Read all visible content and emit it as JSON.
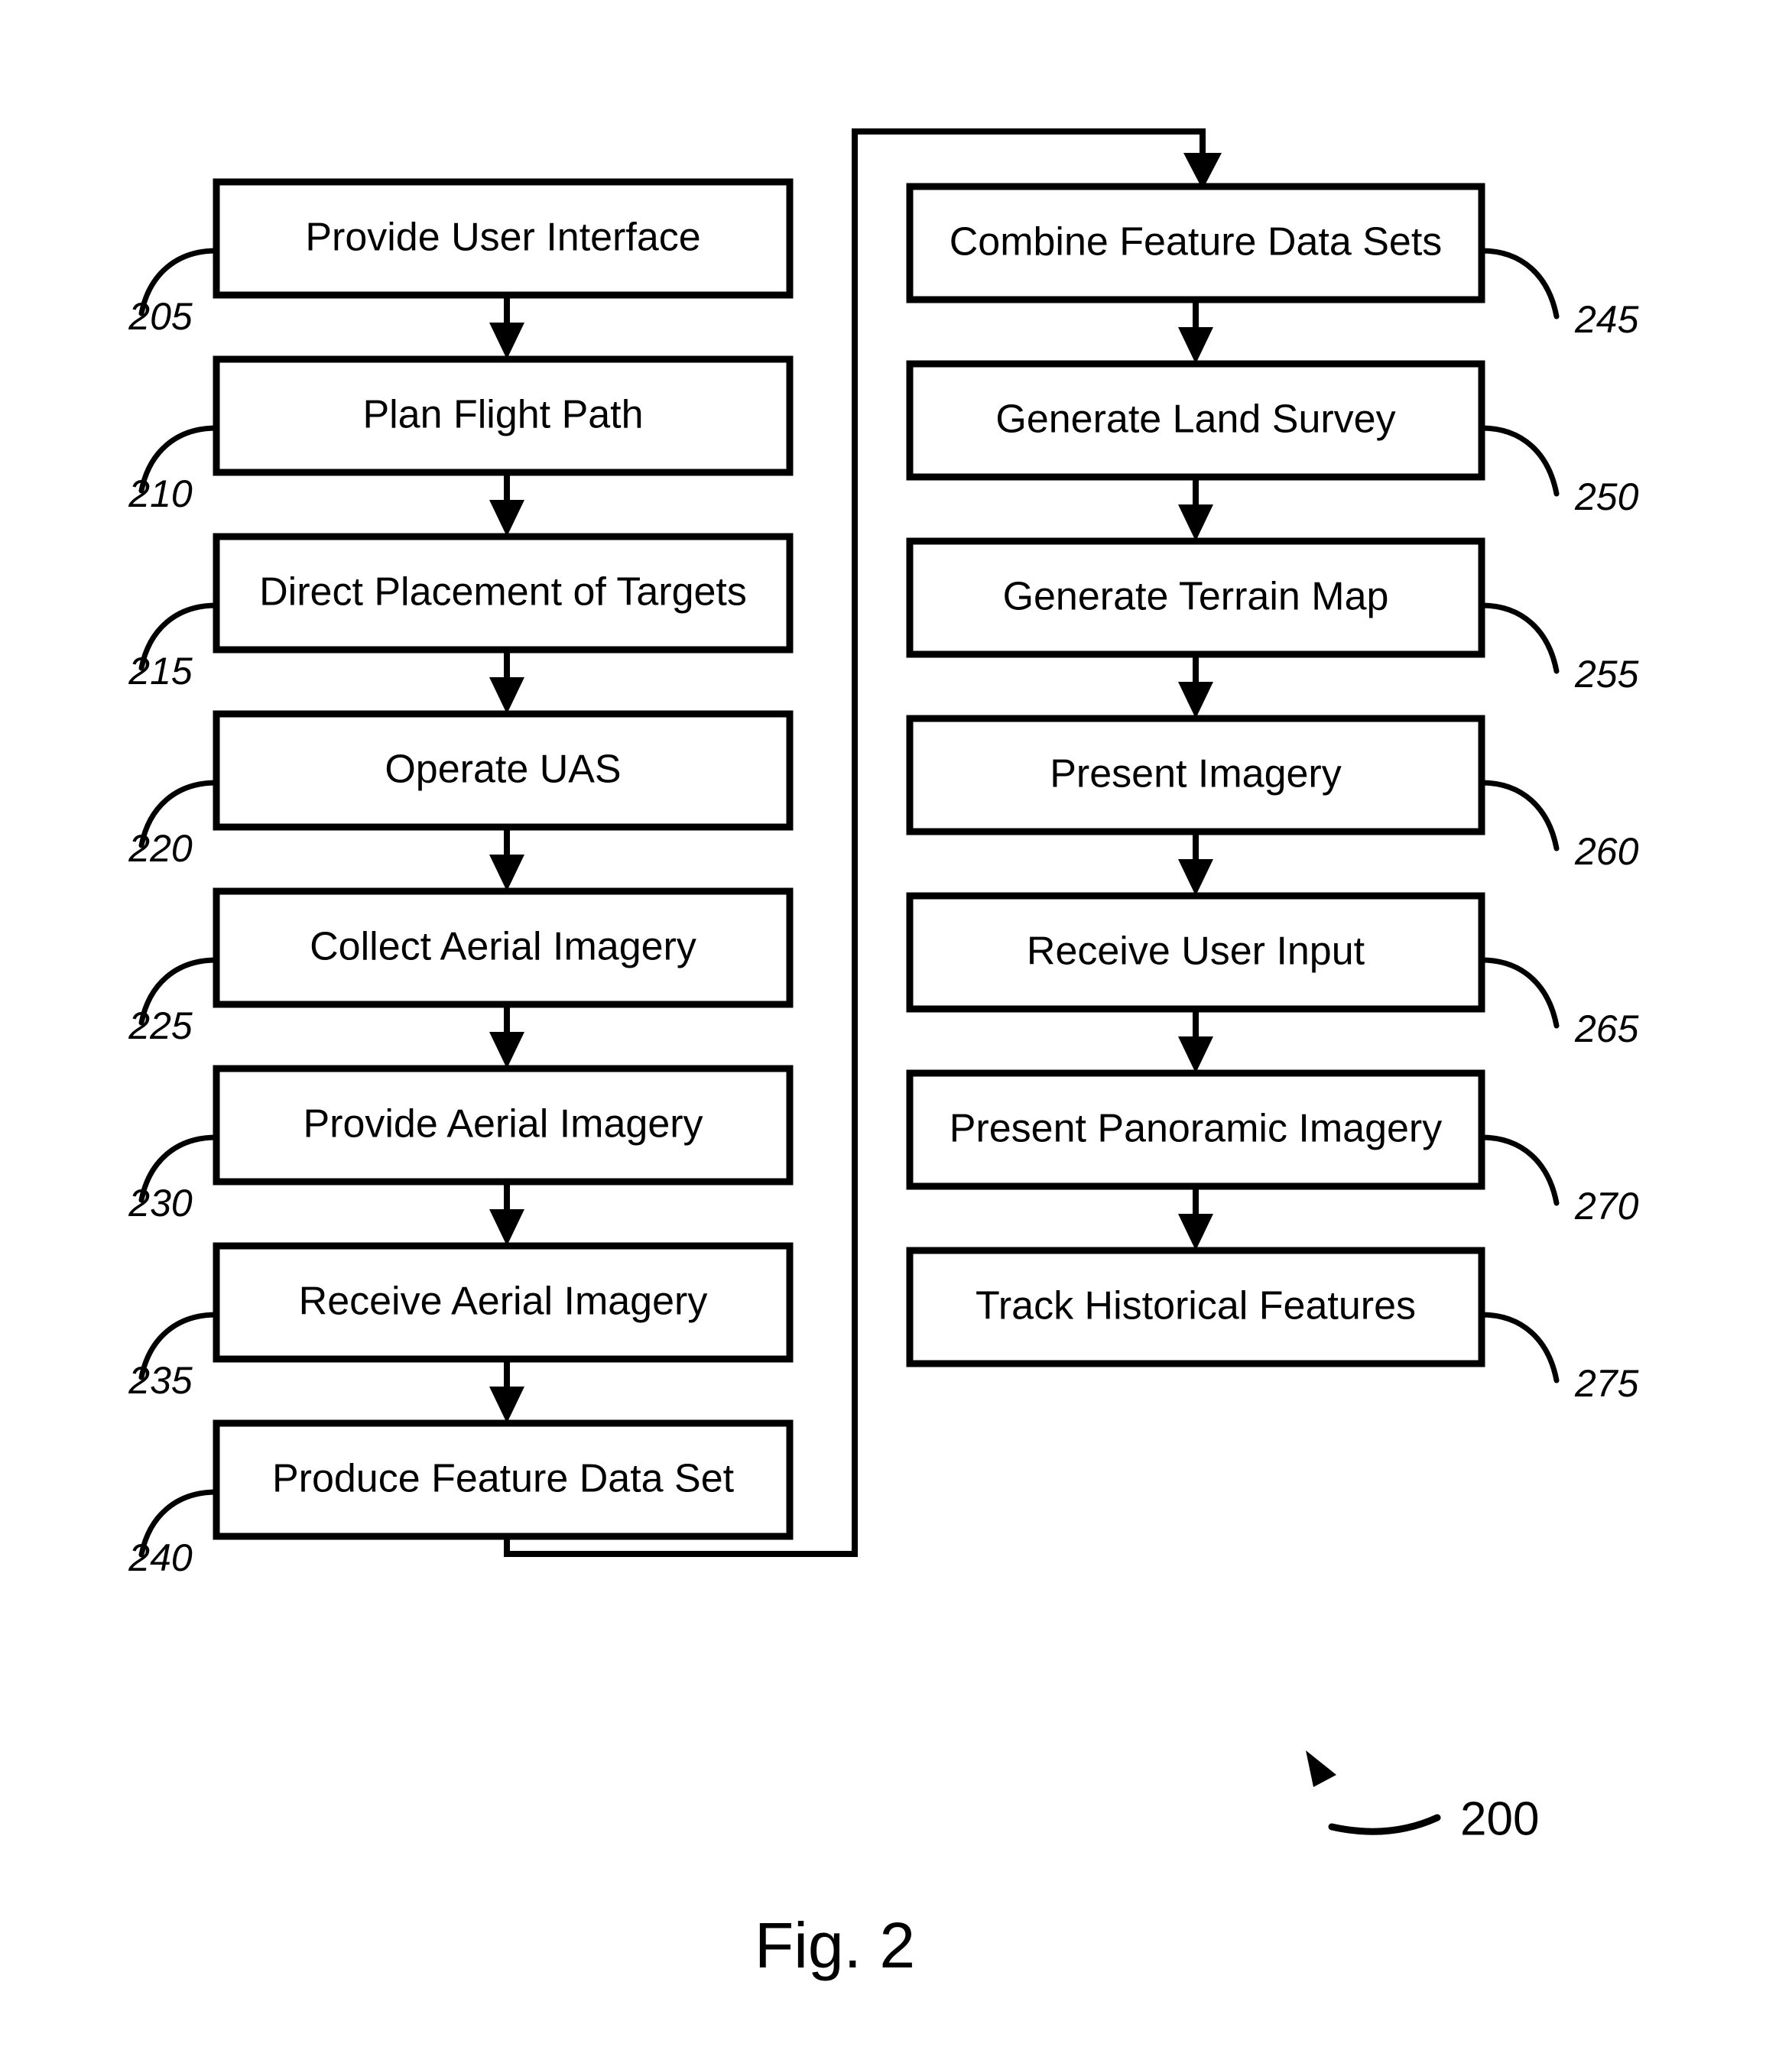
{
  "figure": {
    "caption": "Fig. 2",
    "callout_label": "200"
  },
  "left_column": {
    "steps": [
      {
        "label": "Provide User Interface",
        "ref": "205"
      },
      {
        "label": "Plan Flight Path",
        "ref": "210"
      },
      {
        "label": "Direct Placement of Targets",
        "ref": "215"
      },
      {
        "label": "Operate UAS",
        "ref": "220"
      },
      {
        "label": "Collect Aerial Imagery",
        "ref": "225"
      },
      {
        "label": "Provide Aerial Imagery",
        "ref": "230"
      },
      {
        "label": "Receive Aerial Imagery",
        "ref": "235"
      },
      {
        "label": "Produce Feature Data Set",
        "ref": "240"
      }
    ]
  },
  "right_column": {
    "steps": [
      {
        "label": "Combine Feature Data Sets",
        "ref": "245"
      },
      {
        "label": "Generate Land Survey",
        "ref": "250"
      },
      {
        "label": "Generate Terrain Map",
        "ref": "255"
      },
      {
        "label": "Present Imagery",
        "ref": "260"
      },
      {
        "label": "Receive User Input",
        "ref": "265"
      },
      {
        "label": "Present Panoramic Imagery",
        "ref": "270"
      },
      {
        "label": "Track Historical Features",
        "ref": "275"
      }
    ]
  },
  "colors": {
    "ink": "#000000",
    "paper": "#ffffff"
  }
}
